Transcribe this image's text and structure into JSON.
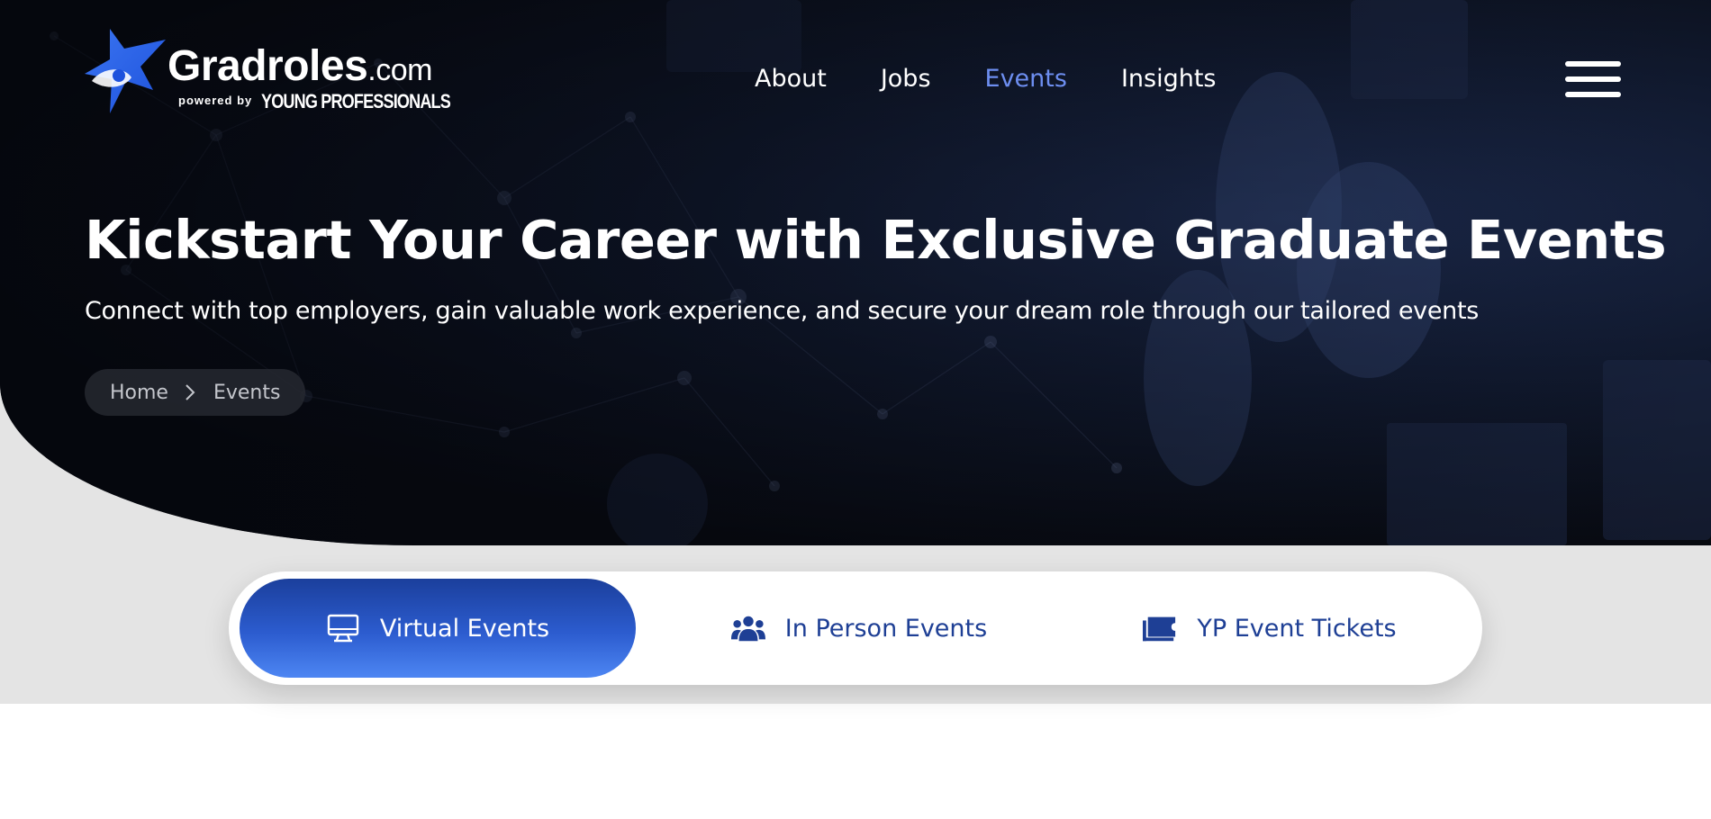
{
  "brand": {
    "name": "Gradroles",
    "tld": ".com",
    "powered_by": "powered by",
    "partner": "YOUNG PROFESSIONALS"
  },
  "nav": {
    "items": [
      {
        "label": "About",
        "active": false
      },
      {
        "label": "Jobs",
        "active": false
      },
      {
        "label": "Events",
        "active": true
      },
      {
        "label": "Insights",
        "active": false
      }
    ],
    "menu_icon": "hamburger-icon"
  },
  "hero": {
    "title": "Kickstart Your Career with Exclusive Graduate Events",
    "subtitle": "Connect with top employers, gain valuable work experience, and secure your dream role through our tailored events"
  },
  "breadcrumb": {
    "items": [
      "Home",
      "Events"
    ],
    "separator_icon": "chevron-right-icon"
  },
  "tabs": {
    "items": [
      {
        "label": "Virtual Events",
        "icon": "monitor-icon",
        "active": true
      },
      {
        "label": "In Person Events",
        "icon": "users-icon",
        "active": false
      },
      {
        "label": "YP Event Tickets",
        "icon": "ticket-icon",
        "active": false
      }
    ]
  },
  "colors": {
    "accent": "#6d8ef0",
    "brand_blue": "#1e3f95",
    "tab_active_start": "#1b3f9c",
    "tab_active_end": "#4d86f3",
    "hero_dark": "#07090f",
    "section_gray": "#e4e4e4"
  }
}
